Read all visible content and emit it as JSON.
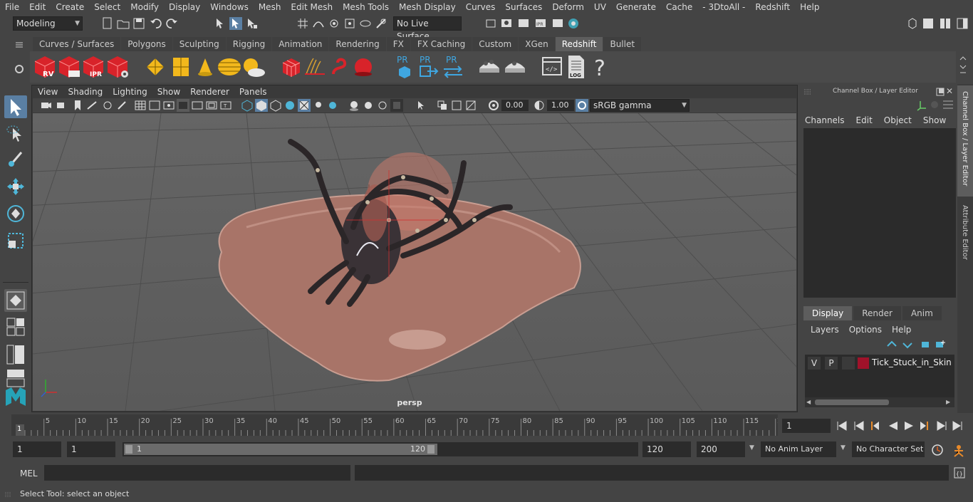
{
  "menus": [
    "File",
    "Edit",
    "Create",
    "Select",
    "Modify",
    "Display",
    "Windows",
    "Mesh",
    "Edit Mesh",
    "Mesh Tools",
    "Mesh Display",
    "Curves",
    "Surfaces",
    "Deform",
    "UV",
    "Generate",
    "Cache",
    "- 3DtoAll -",
    "Redshift",
    "Help"
  ],
  "statusline": {
    "mode": "Modeling",
    "live_surface": "No Live Surface"
  },
  "shelf_tabs": [
    "Curves / Surfaces",
    "Polygons",
    "Sculpting",
    "Rigging",
    "Animation",
    "Rendering",
    "FX",
    "FX Caching",
    "Custom",
    "XGen",
    "Redshift",
    "Bullet"
  ],
  "shelf_active": "Redshift",
  "shelf_icon_labels": {
    "rv": "RV",
    "ipr": "IPR",
    "pr": "PR",
    "log": "LOG",
    "help": "?"
  },
  "viewport": {
    "menus": [
      "View",
      "Shading",
      "Lighting",
      "Show",
      "Renderer",
      "Panels"
    ],
    "exposure": "0.00",
    "gamma": "1.00",
    "colorspace": "sRGB gamma",
    "camera_label": "persp"
  },
  "channel_box": {
    "title": "Channel Box / Layer Editor",
    "menus": [
      "Channels",
      "Edit",
      "Object",
      "Show"
    ]
  },
  "layer_editor": {
    "tabs": [
      "Display",
      "Render",
      "Anim"
    ],
    "menus": [
      "Layers",
      "Options",
      "Help"
    ],
    "layer": {
      "v": "V",
      "p": "P",
      "name": "Tick_Stuck_in_Skin",
      "color": "#a0122a"
    }
  },
  "side_tabs": [
    "Channel Box / Layer Editor",
    "Attribute Editor"
  ],
  "timeline": {
    "ticks": [
      "5",
      "10",
      "15",
      "20",
      "25",
      "30",
      "35",
      "40",
      "45",
      "50",
      "55",
      "60",
      "65",
      "70",
      "75",
      "80",
      "85",
      "90",
      "95",
      "100",
      "105",
      "110",
      "115",
      "12"
    ],
    "start_marker": "1",
    "current_frame": "1"
  },
  "range": {
    "start": "1",
    "playback_start": "1",
    "slider_start": "1",
    "slider_end": "120",
    "playback_end": "120",
    "end": "200",
    "anim_layer": "No Anim Layer",
    "character_set": "No Character Set"
  },
  "cmd": {
    "label": "MEL"
  },
  "help_text": "Select Tool: select an object"
}
